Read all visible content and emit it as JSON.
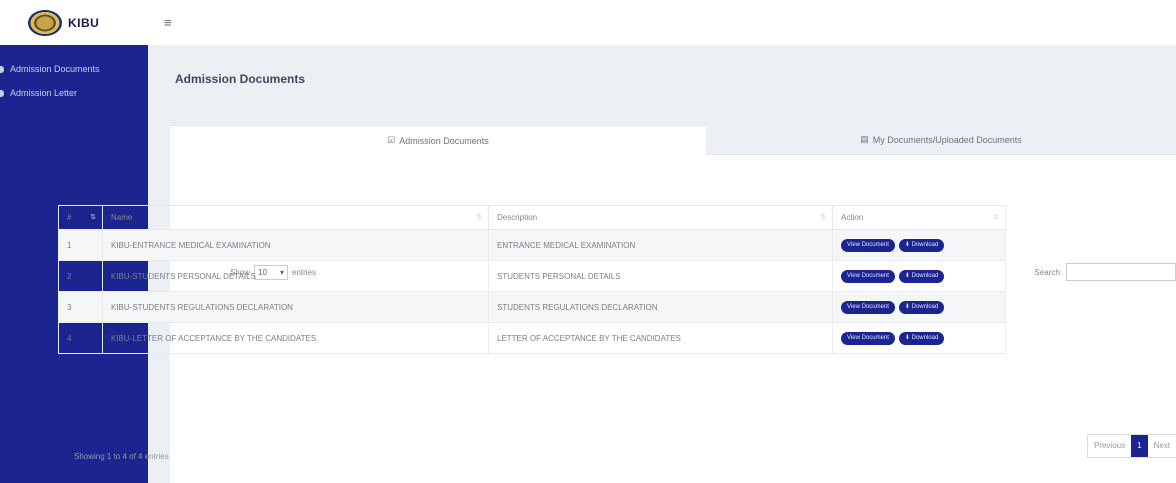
{
  "brand": {
    "name": "KIBU",
    "menu_glyph": "≡"
  },
  "sidebar": {
    "items": [
      {
        "label": "Admission Documents"
      },
      {
        "label": "Admission Letter"
      }
    ]
  },
  "page": {
    "title": "Admission Documents"
  },
  "tabs": [
    {
      "icon": "☑",
      "label": "Admission Documents"
    },
    {
      "icon": "▤",
      "label": "My Documents/Uploaded Documents"
    }
  ],
  "controls": {
    "show_label": "Show",
    "length_value": "10",
    "entries_label": "entries",
    "search_label": "Search:"
  },
  "table": {
    "headers": [
      "#",
      "Name",
      "Description",
      "Action"
    ],
    "rows": [
      {
        "num": "1",
        "name": "KIBU-ENTRANCE MEDICAL EXAMINATION",
        "desc": "ENTRANCE MEDICAL EXAMINATION"
      },
      {
        "num": "2",
        "name": "KIBU-STUDENTS PERSONAL DETAILS",
        "desc": "STUDENTS PERSONAL DETAILS"
      },
      {
        "num": "3",
        "name": "KIBU-STUDENTS REGULATIONS DECLARATION",
        "desc": "STUDENTS REGULATIONS DECLARATION"
      },
      {
        "num": "4",
        "name": "KIBU-LETTER OF ACCEPTANCE BY THE CANDIDATES",
        "desc": "LETTER OF ACCEPTANCE BY THE CANDIDATES"
      }
    ],
    "view_label": "View Document",
    "download_label": "⬇ Download"
  },
  "footer": {
    "info": "Showing 1 to 4 of 4 entries",
    "prev": "Previous",
    "page": "1",
    "next": "Next"
  },
  "colors": {
    "sidebar": "#1c248f",
    "accent": "#1c248f",
    "background": "#eceff4"
  }
}
